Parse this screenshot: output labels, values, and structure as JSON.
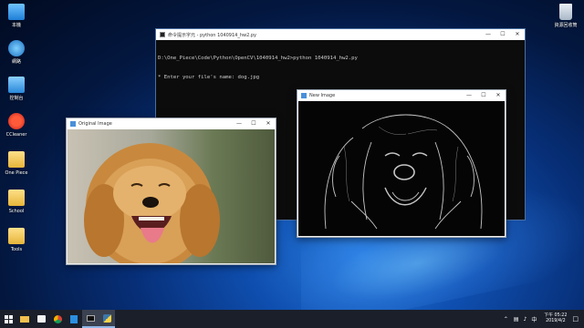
{
  "desktop": {
    "icons_left": [
      {
        "label": "本機"
      },
      {
        "label": "網路"
      },
      {
        "label": "控制台"
      },
      {
        "label": "CCleaner"
      },
      {
        "label": "One Piece"
      },
      {
        "label": "School"
      },
      {
        "label": "Tools"
      }
    ],
    "icon_right": {
      "label": "資源回收筒"
    }
  },
  "console": {
    "title": "命令提示字元 - python  1040914_hw2.py",
    "lines": [
      "D:\\One_Piece\\Code\\Python\\OpenCV\\1040914_hw2>python 1040914_hw2.py",
      "* Enter your file's name: dog.jpg"
    ]
  },
  "original_window": {
    "title": "Original Image"
  },
  "new_window": {
    "title": "New Image"
  },
  "taskbar": {
    "clock_time": "下午 05:22",
    "clock_date": "2019/4/2"
  },
  "colors": {
    "accent": "#0078d7",
    "taskbar": "#1a1f2a"
  }
}
